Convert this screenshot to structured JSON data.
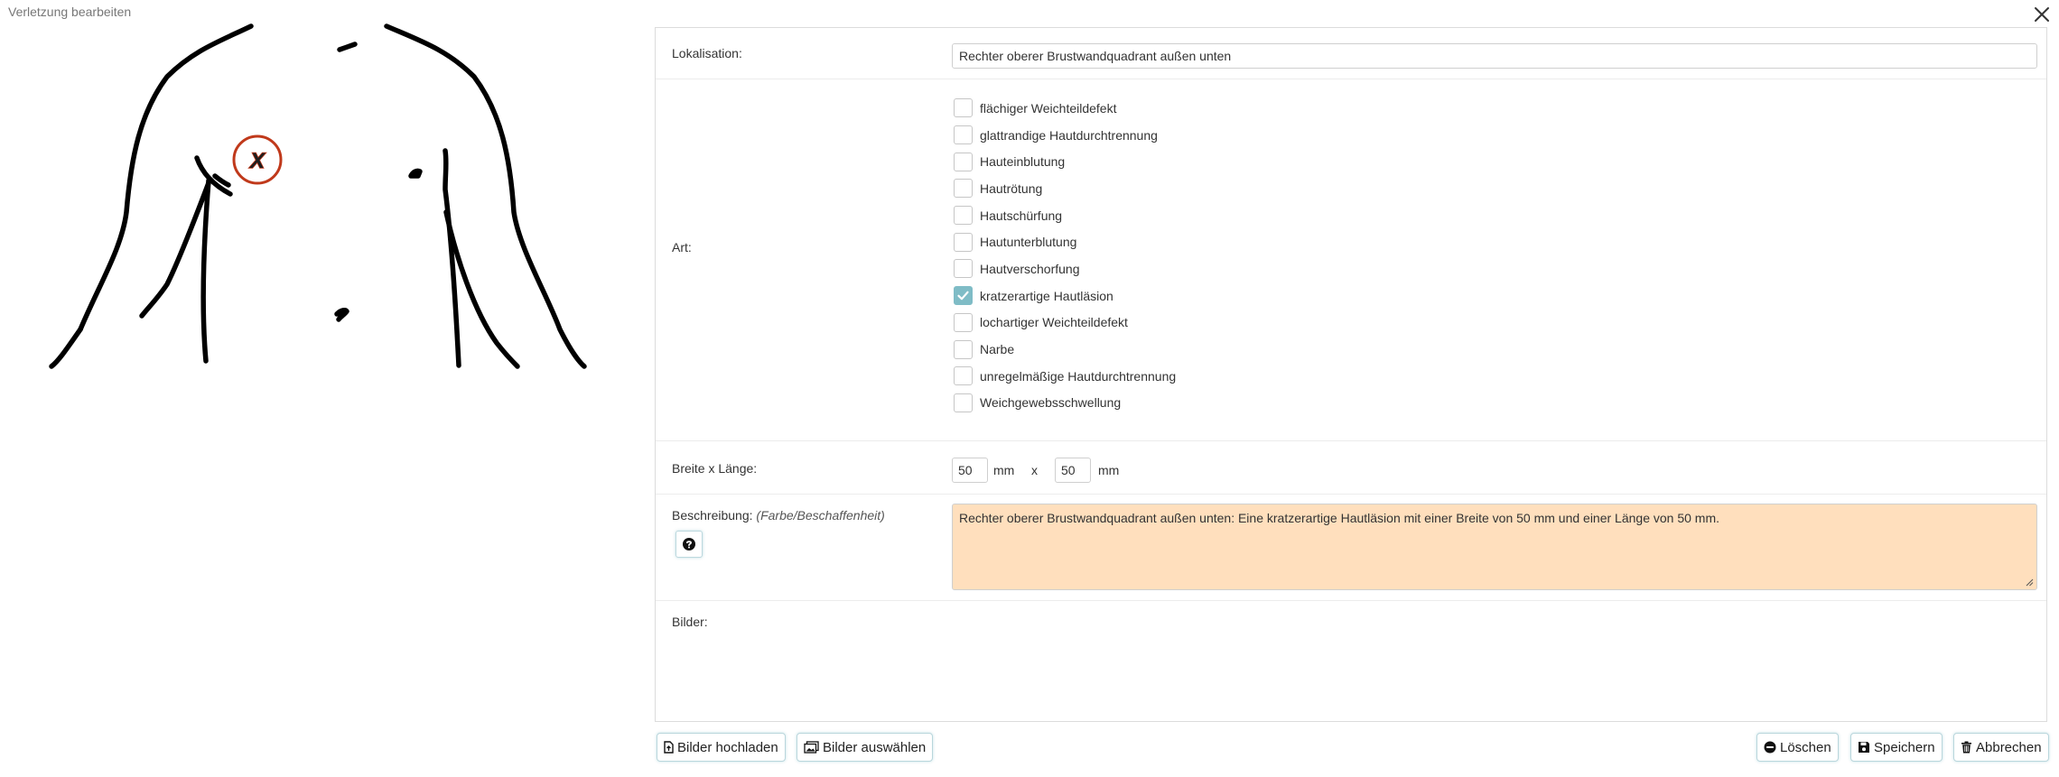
{
  "dialog": {
    "title": "Verletzung bearbeiten"
  },
  "form": {
    "localisation": {
      "label": "Lokalisation:",
      "value": "Rechter oberer Brustwandquadrant außen unten"
    },
    "art": {
      "label": "Art:",
      "options": [
        {
          "label": "flächiger Weichteildefekt",
          "checked": false
        },
        {
          "label": "glattrandige Hautdurchtrennung",
          "checked": false
        },
        {
          "label": "Hauteinblutung",
          "checked": false
        },
        {
          "label": "Hautrötung",
          "checked": false
        },
        {
          "label": "Hautschürfung",
          "checked": false
        },
        {
          "label": "Hautunterblutung",
          "checked": false
        },
        {
          "label": "Hautverschorfung",
          "checked": false
        },
        {
          "label": "kratzerartige Hautläsion",
          "checked": true
        },
        {
          "label": "lochartiger Weichteildefekt",
          "checked": false
        },
        {
          "label": "Narbe",
          "checked": false
        },
        {
          "label": "unregelmäßige Hautdurchtrennung",
          "checked": false
        },
        {
          "label": "Weichgewebsschwellung",
          "checked": false
        }
      ]
    },
    "size": {
      "label": "Breite x Länge:",
      "width": "50",
      "length": "50",
      "unit": "mm",
      "separator": "x"
    },
    "description": {
      "label": "Beschreibung:",
      "hint": "(Farbe/Beschaffenheit)",
      "value": "Rechter oberer Brustwandquadrant außen unten: Eine kratzerartige Hautläsion mit einer Breite von 50 mm und einer Länge von 50 mm."
    },
    "images": {
      "label": "Bilder:"
    }
  },
  "buttons": {
    "upload": "Bilder hochladen",
    "select": "Bilder auswählen",
    "delete": "Löschen",
    "save": "Speichern",
    "cancel": "Abbrechen"
  },
  "marker": {
    "label": "X"
  },
  "colors": {
    "accent": "#7fbcc6",
    "marker": "#c0391b",
    "description_bg": "#ffdfbd"
  }
}
